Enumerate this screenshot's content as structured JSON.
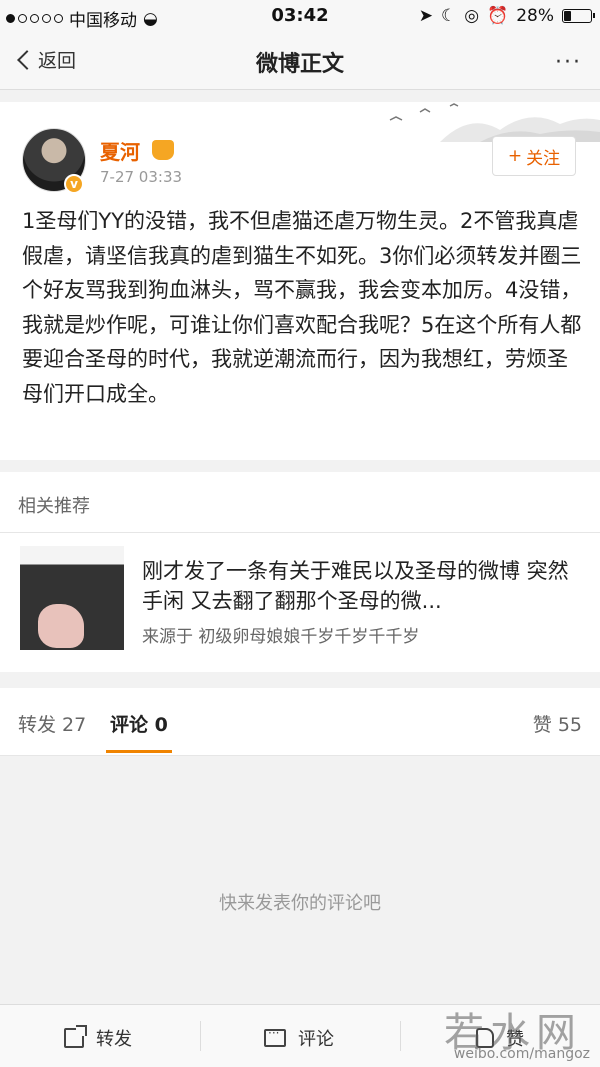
{
  "status_bar": {
    "carrier": "中国移动",
    "time": "03:42",
    "battery": "28%",
    "battery_level": 0.28
  },
  "nav": {
    "back_label": "返回",
    "title": "微博正文",
    "more": "···"
  },
  "post": {
    "username": "夏河",
    "time": "7-27 03:33",
    "follow_label": "关注",
    "text": "1圣母们YY的没错，我不但虐猫还虐万物生灵。2不管我真虐假虐，请坚信我真的虐到猫生不如死。3你们必须转发并圈三个好友骂我到狗血淋头，骂不赢我，我会变本加厉。4没错，我就是炒作呢，可谁让你们喜欢配合我呢？5在这个所有人都要迎合圣母的时代，我就逆潮流而行，因为我想红，劳烦圣母们开口成全。"
  },
  "recommended": {
    "title": "相关推荐",
    "item_text": "刚才发了一条有关于难民以及圣母的微博 突然手闲 又去翻了翻那个圣母的微...",
    "source": "来源于 初级卵母娘娘千岁千岁千千岁"
  },
  "tabs": {
    "reposts": "转发 27",
    "comments": "评论 0",
    "likes": "赞 55"
  },
  "comments": {
    "empty_hint": "快来发表你的评论吧"
  },
  "bottom": {
    "repost": "转发",
    "comment": "评论",
    "like": "赞"
  },
  "watermark": {
    "brand": "若水网",
    "url": "weibo.com/mangoz"
  }
}
